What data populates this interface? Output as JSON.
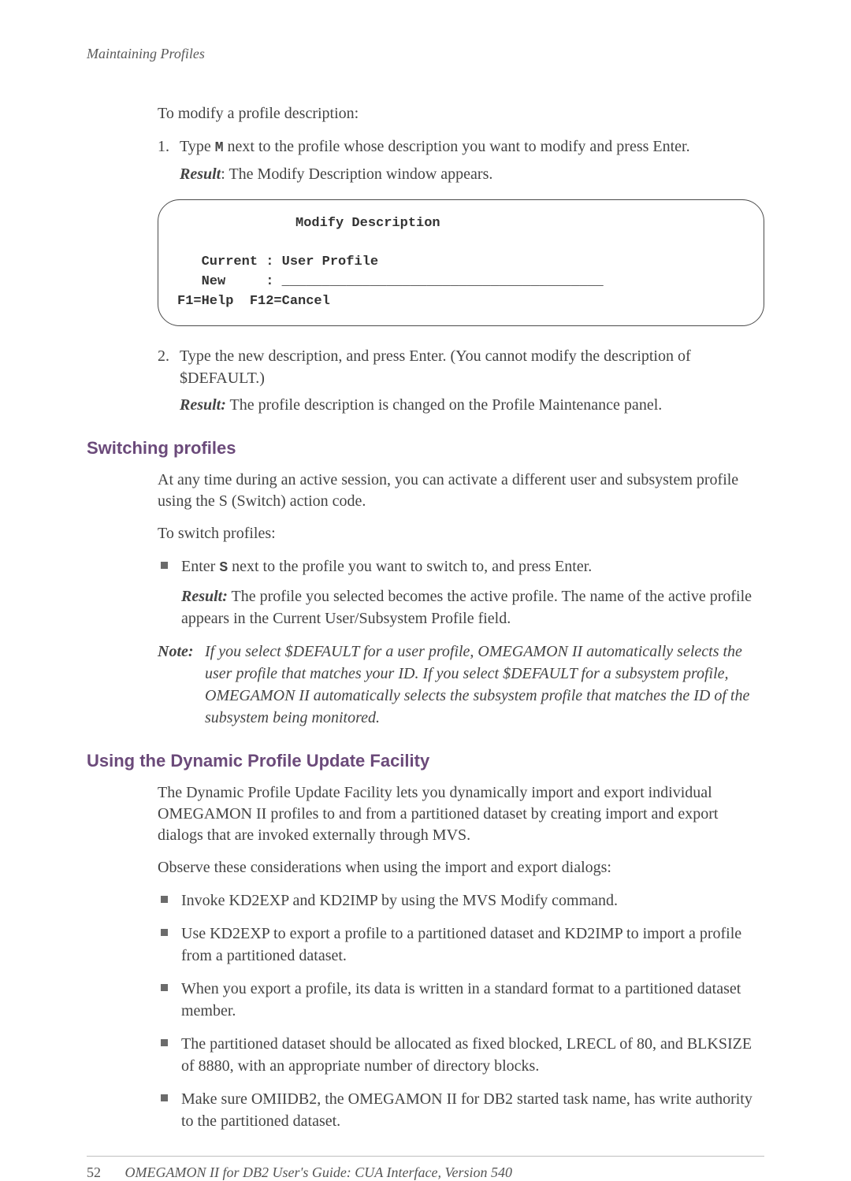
{
  "running_head": "Maintaining Profiles",
  "intro_para": "To modify a profile description:",
  "step1": {
    "marker": "1.",
    "pre": "Type ",
    "code": "M",
    "post": " next to the profile whose description you want to modify and press Enter.",
    "result_label": "Result",
    "result_text": ": The Modify Description window appears."
  },
  "panel": {
    "title": "Modify Description",
    "current": "Current : User Profile",
    "new": "New     : ________________________________________",
    "keys": "F1=Help  F12=Cancel"
  },
  "step2": {
    "marker": "2.",
    "text": "Type the new description, and press Enter. (You cannot modify the description of $DEFAULT.)",
    "result_label": "Result:",
    "result_text": " The profile description is changed on the Profile Maintenance panel."
  },
  "switching": {
    "heading": "Switching profiles",
    "p1": "At any time during an active session, you can activate a different user and subsystem profile using the S (Switch) action code.",
    "p2": "To switch profiles:",
    "bullet_pre": "Enter ",
    "bullet_code": "S",
    "bullet_post": " next to the profile you want to switch to, and press Enter.",
    "result_label": "Result:",
    "result_text": " The profile you selected becomes the active profile. The name of the active profile appears in the Current User/Subsystem Profile field.",
    "note_label": "Note:",
    "note_text": "If you select $DEFAULT for a user profile, OMEGAMON II automatically selects the user profile that matches your ID. If you select $DEFAULT for a subsystem profile, OMEGAMON II automatically selects the subsystem profile that matches the ID of the subsystem being monitored."
  },
  "dynamic": {
    "heading": "Using the Dynamic Profile Update Facility",
    "p1": "The Dynamic Profile Update Facility lets you dynamically import and export individual OMEGAMON II profiles to and from a partitioned dataset by creating import and export dialogs that are invoked externally through MVS.",
    "p2": "Observe these considerations when using the import and export dialogs:",
    "bullets": [
      "Invoke KD2EXP and KD2IMP by using the MVS Modify command.",
      "Use KD2EXP to export a profile to a partitioned dataset and KD2IMP to import a profile from a partitioned dataset.",
      "When you export a profile, its data is written in a standard format to a partitioned dataset member.",
      "The partitioned dataset should be allocated as fixed blocked, LRECL of 80, and BLKSIZE of 8880, with an appropriate number of directory blocks.",
      "Make sure OMIIDB2, the OMEGAMON II for DB2 started task name, has write authority to the partitioned dataset."
    ]
  },
  "footer": {
    "page": "52",
    "title": "OMEGAMON II for DB2 User's Guide: CUA Interface, Version 540"
  }
}
